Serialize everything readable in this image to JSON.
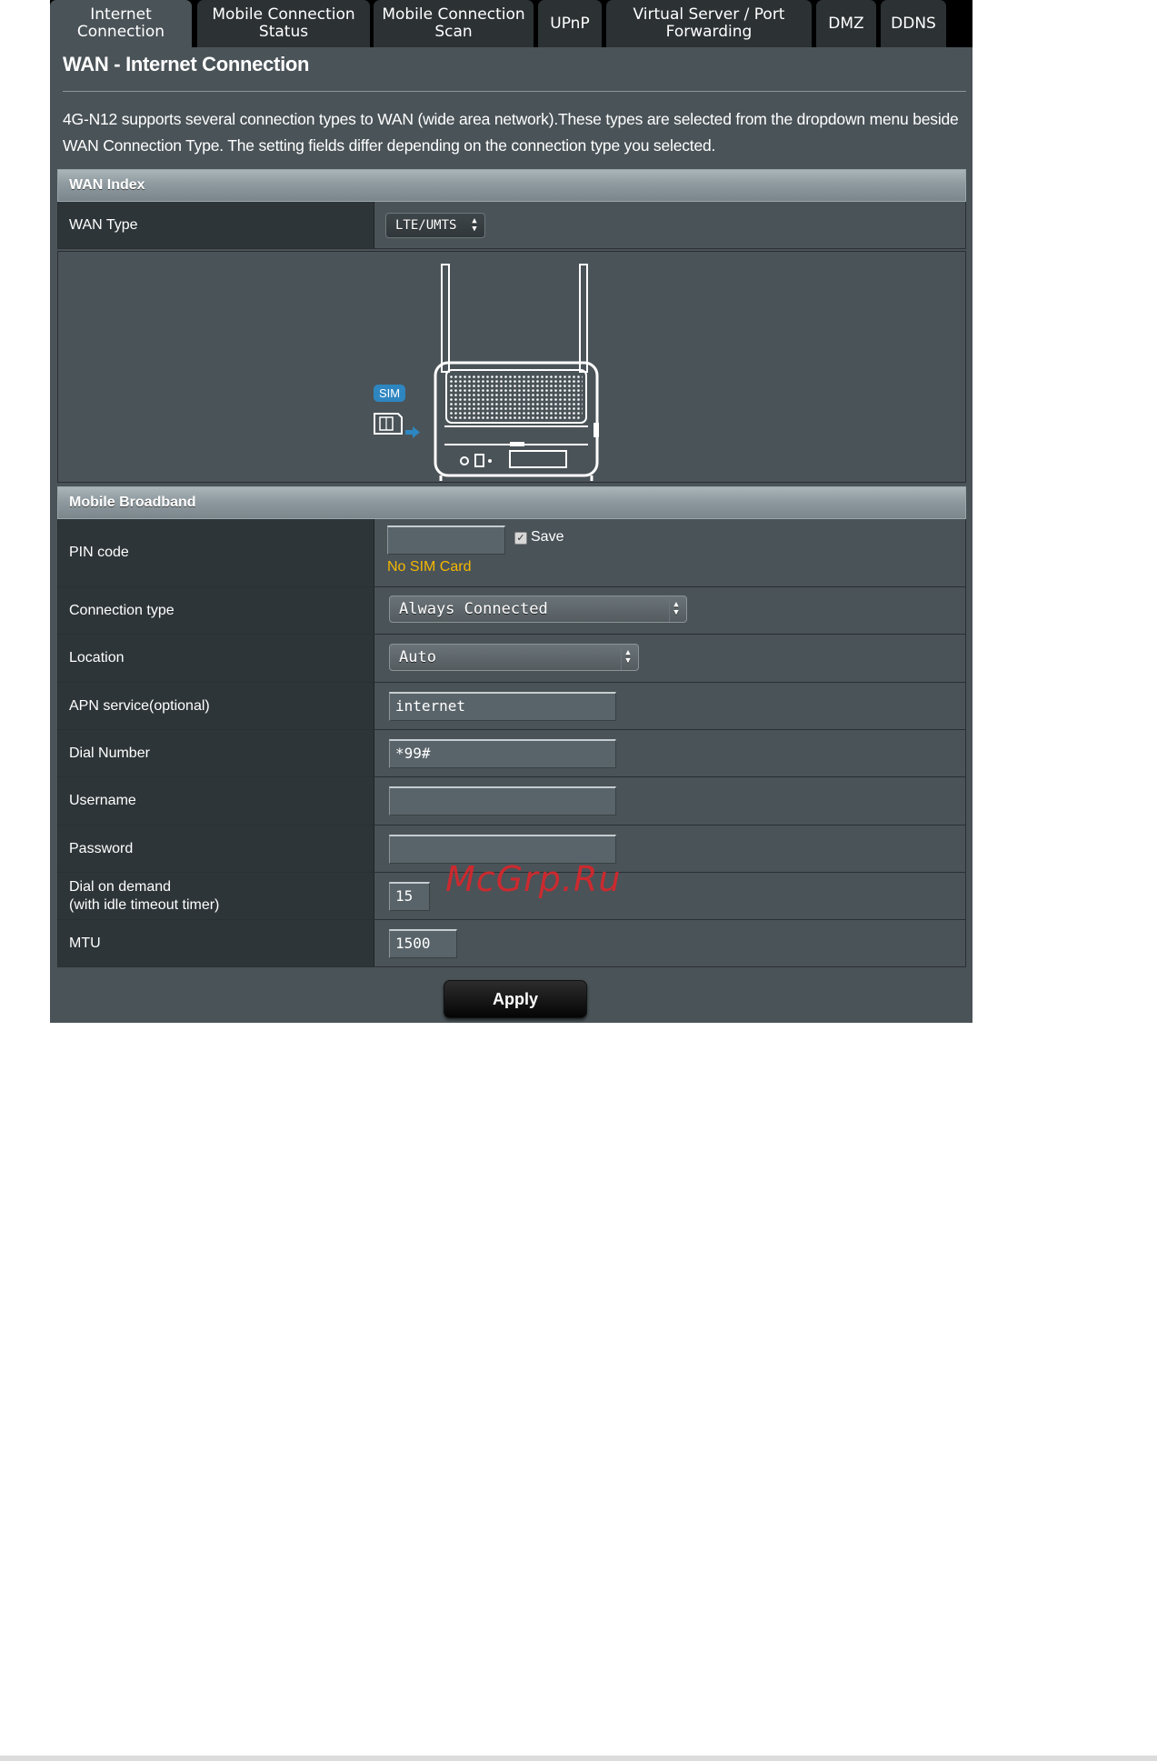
{
  "tabs": [
    {
      "label": "Internet\nConnection",
      "active": true
    },
    {
      "label": "Mobile Connection\nStatus",
      "active": false
    },
    {
      "label": "Mobile Connection\nScan",
      "active": false
    },
    {
      "label": "UPnP",
      "active": false
    },
    {
      "label": "Virtual Server / Port\nForwarding",
      "active": false
    },
    {
      "label": "DMZ",
      "active": false
    },
    {
      "label": "DDNS",
      "active": false
    }
  ],
  "page": {
    "title": "WAN - Internet Connection",
    "intro": "4G-N12 supports several connection types to WAN (wide area network).These types are selected from the dropdown menu beside WAN Connection Type. The setting fields differ depending on the connection type you selected."
  },
  "wan_index": {
    "header": "WAN Index",
    "wan_type_label": "WAN Type",
    "wan_type_value": "LTE/UMTS"
  },
  "illustration": {
    "sim_badge": "SIM"
  },
  "mobile_broadband": {
    "header": "Mobile Broadband",
    "pin_label": "PIN code",
    "pin_value": "",
    "save_label": "Save",
    "save_checked": true,
    "sim_status": "No SIM Card",
    "connection_type_label": "Connection type",
    "connection_type_value": "Always Connected",
    "location_label": "Location",
    "location_value": "Auto",
    "apn_label": "APN service(optional)",
    "apn_value": "internet",
    "dial_number_label": "Dial Number",
    "dial_number_value": "*99#",
    "username_label": "Username",
    "username_value": "",
    "password_label": "Password",
    "password_value": "",
    "dial_on_demand_label_1": "Dial on demand",
    "dial_on_demand_label_2": "(with idle timeout timer)",
    "dial_on_demand_value": "15",
    "mtu_label": "MTU",
    "mtu_value": "1500"
  },
  "apply_label": "Apply",
  "watermark": "McGrp.Ru",
  "colors": {
    "panel_bg": "#4a5358",
    "label_bg": "#2e3538",
    "warning_text": "#f5b800",
    "sim_blue": "#2e86c1",
    "watermark_red": "#d9262b"
  }
}
